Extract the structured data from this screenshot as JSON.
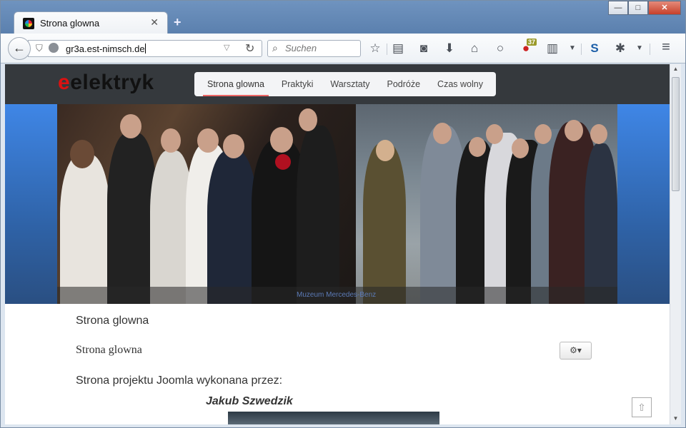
{
  "window": {
    "minimize": "—",
    "maximize": "□",
    "close": "✕"
  },
  "tab": {
    "title": "Strona glowna",
    "close": "✕",
    "new_tab": "+"
  },
  "nav": {
    "back": "←",
    "url": "gr3a.est-nimsch.de",
    "search_placeholder": "Suchen",
    "notification_count": "37",
    "icons": [
      "bookmark-star-icon",
      "reading-list-icon",
      "pocket-icon",
      "download-icon",
      "home-icon",
      "chat-icon",
      "notification-icon",
      "clipboard-icon",
      "dropdown-icon",
      "s-extension-icon",
      "bug-icon",
      "dropdown-icon",
      "menu-icon"
    ]
  },
  "site": {
    "logo_e": "e",
    "logo_rest": "elektryk",
    "menu": [
      "Strona glowna",
      "Praktyki",
      "Warsztaty",
      "Podróże",
      "Czas wolny"
    ],
    "hero_caption": "Muzeum Mercedes-Benz"
  },
  "content": {
    "breadcrumb": "Strona glowna",
    "page_title": "Strona glowna",
    "gear_label": "⚙▾",
    "intro": "Strona projektu Joomla wykonana przez:",
    "author": "Jakub Szwedzik",
    "scroll_top": "⇧"
  },
  "colors": {
    "header_bg": "#35393d",
    "hero_blue": "#3f86e6",
    "menu_active_underline": "#e66"
  }
}
